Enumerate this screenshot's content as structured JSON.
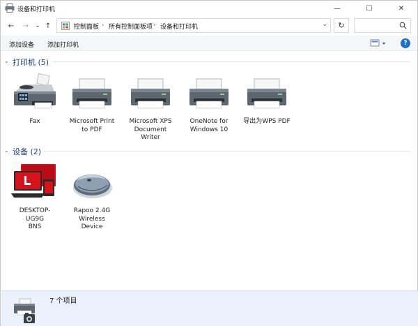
{
  "window": {
    "title": "设备和打印机",
    "controls": {
      "minimize": "—",
      "maximize": "☐",
      "close": "✕"
    }
  },
  "nav": {
    "back": "←",
    "forward": "→",
    "recent": "⌄",
    "up": "↑",
    "breadcrumb": [
      "控制面板",
      "所有控制面板项",
      "设备和打印机"
    ],
    "refresh": "↻",
    "search_placeholder": ""
  },
  "toolbar": {
    "add_device": "添加设备",
    "add_printer": "添加打印机",
    "help": "?"
  },
  "groups": {
    "printers": {
      "label": "打印机 (5)",
      "items": [
        {
          "name": "Fax",
          "icon": "fax-icon"
        },
        {
          "name": "Microsoft Print to PDF",
          "icon": "printer-icon"
        },
        {
          "name": "Microsoft XPS Document Writer",
          "icon": "printer-icon"
        },
        {
          "name": "OneNote for Windows 10",
          "icon": "printer-icon"
        },
        {
          "name": "导出为WPS PDF",
          "icon": "printer-icon"
        }
      ]
    },
    "devices": {
      "label": "设备 (2)",
      "items": [
        {
          "name": "DESKTOP-UG9GBNS",
          "icon": "computer-icon"
        },
        {
          "name": "Rapoo 2.4G Wireless Device",
          "icon": "mouse-icon"
        }
      ]
    }
  },
  "details": {
    "count": "7 个项目"
  },
  "colors": {
    "group_header": "#1e3e87",
    "details_bg": "#eaf1fa",
    "help_blue": "#1a6fd0",
    "computer_red": "#d6121a"
  }
}
